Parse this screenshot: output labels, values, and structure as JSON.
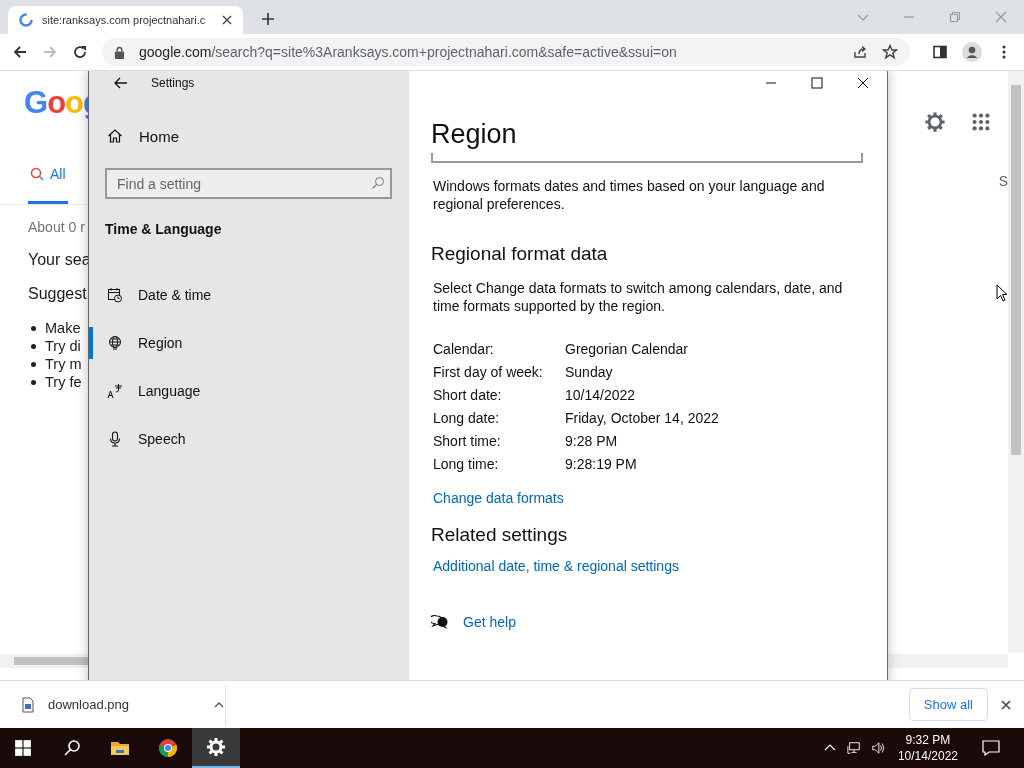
{
  "browser": {
    "tab": {
      "title": "site:ranksays.com projectnahari.c"
    },
    "address": {
      "host": "google.com",
      "path": "/search?q=site%3Aranksays.com+projectnahari.com&safe=active&ssui=on"
    }
  },
  "google": {
    "logo": "Goog",
    "tabs": [
      {
        "label": "All",
        "selected": true
      }
    ],
    "cut_tab": "S",
    "result_stats": "About 0 r",
    "lines": [
      "Your sea",
      "Suggest"
    ],
    "bullets": [
      "Make",
      "Try di",
      "Try m",
      "Try fe"
    ]
  },
  "settings": {
    "title": "Settings",
    "home": "Home",
    "search": {
      "placeholder": "Find a setting"
    },
    "section": "Time & Language",
    "nav": [
      {
        "label": "Date & time",
        "kind": "calendar",
        "selected": false
      },
      {
        "label": "Region",
        "kind": "globe",
        "selected": true
      },
      {
        "label": "Language",
        "kind": "language",
        "selected": false
      },
      {
        "label": "Speech",
        "kind": "mic",
        "selected": false
      }
    ],
    "page_title": "Region",
    "intro": "Windows formats dates and times based on your language and regional preferences.",
    "format_heading": "Regional format data",
    "format_text": "Select Change data formats to switch among calendars, date, and time formats supported by the region.",
    "rows": [
      {
        "label": "Calendar:",
        "value": "Gregorian Calendar"
      },
      {
        "label": "First day of week:",
        "value": "Sunday"
      },
      {
        "label": "Short date:",
        "value": "10/14/2022"
      },
      {
        "label": "Long date:",
        "value": "Friday, October 14, 2022"
      },
      {
        "label": "Short time:",
        "value": "9:28 PM"
      },
      {
        "label": "Long time:",
        "value": "9:28:19 PM"
      }
    ],
    "change_link": "Change data formats",
    "related_heading": "Related settings",
    "related_link": "Additional date, time & regional settings",
    "help_link": "Get help"
  },
  "downloads": {
    "file": "download.png",
    "show_all": "Show all"
  },
  "taskbar": {
    "apps": [
      {
        "kind": "search",
        "active": false
      },
      {
        "kind": "folder",
        "active": false
      },
      {
        "kind": "chrome",
        "active": false
      },
      {
        "kind": "settings",
        "active": true
      }
    ],
    "time": "9:32 PM",
    "date": "10/14/2022"
  }
}
